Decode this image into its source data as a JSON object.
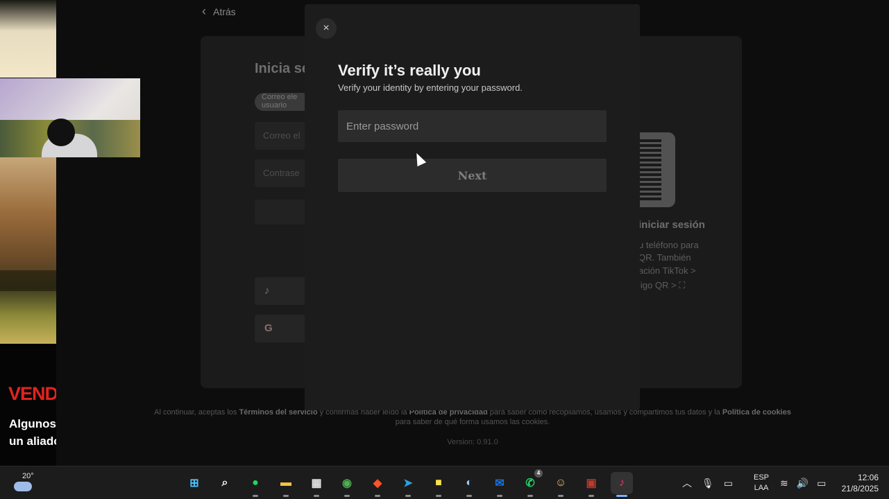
{
  "stream_overlay": {
    "headline": "VENDA",
    "line1": "Algunos c",
    "line2": "un aliado"
  },
  "background_page": {
    "back_label": "Atrás",
    "title": "Inicia se",
    "pill_label": "Correo ele usuario",
    "email_placeholder": "Correo el",
    "password_placeholder": "Contrase",
    "social_tiktok_icon": "tiktok-icon",
    "social_google_icon": "google-icon",
    "qr_title": "iniciar sesión",
    "qr_lines": [
      "u teléfono para",
      "QR. También",
      "ación TikTok >",
      "ligo QR >"
    ],
    "legal_text_1": "Al continuar, aceptas los ",
    "legal_terms": "Términos del servicio",
    "legal_text_2": " y confirmas haber leído la ",
    "legal_privacy": "Política de privacidad",
    "legal_text_3": " para saber cómo recopilamos, usamos y compartimos tus datos y la ",
    "legal_cookies": "Política de cookies",
    "legal_text_4": " para saber de qué forma usamos las cookies.",
    "version": "Version: 0.91.0"
  },
  "modal": {
    "close_glyph": "×",
    "title": "Verify it’s really you",
    "subtitle": "Verify your identity by entering your password.",
    "password_placeholder": "Enter password",
    "password_value": "",
    "next_label": "Next"
  },
  "taskbar": {
    "temperature": "20°",
    "apps": [
      {
        "name": "windows-start",
        "glyph": "⊞",
        "color": "#4cc2ff"
      },
      {
        "name": "search",
        "glyph": "⌕",
        "color": "#ffffff"
      },
      {
        "name": "spotify",
        "glyph": "●",
        "color": "#1ed760"
      },
      {
        "name": "file-explorer",
        "glyph": "▬",
        "color": "#f4c542"
      },
      {
        "name": "microsoft-store",
        "glyph": "▦",
        "color": "#e6e6e6"
      },
      {
        "name": "chrome",
        "glyph": "◉",
        "color": "#4caf50"
      },
      {
        "name": "brave",
        "glyph": "◆",
        "color": "#fb542b"
      },
      {
        "name": "telegram",
        "glyph": "➤",
        "color": "#2aa3e0"
      },
      {
        "name": "sticky-notes",
        "glyph": "■",
        "color": "#f9e14b"
      },
      {
        "name": "steam",
        "glyph": "◐",
        "color": "#9ec9ef"
      },
      {
        "name": "outlook",
        "glyph": "✉",
        "color": "#1a73e8"
      },
      {
        "name": "whatsapp",
        "glyph": "✆",
        "color": "#25d366",
        "badge": "4"
      },
      {
        "name": "discord-avatar",
        "glyph": "☺",
        "color": "#f0c27a"
      },
      {
        "name": "game-app",
        "glyph": "▣",
        "color": "#c0392b"
      },
      {
        "name": "tiktok",
        "glyph": "♪",
        "color": "#ff2d6b",
        "active": true
      }
    ],
    "language_top": "ESP",
    "language_bottom": "LAA",
    "time": "12:06",
    "date": "21/8/2025"
  }
}
